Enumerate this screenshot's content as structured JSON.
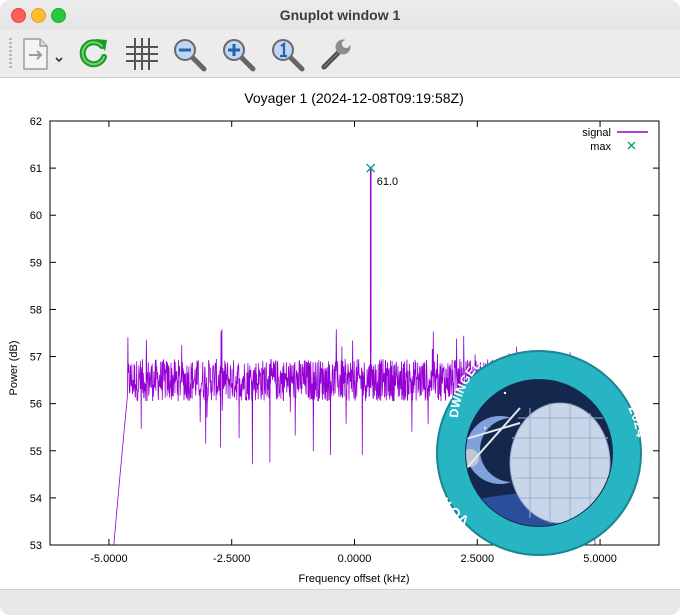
{
  "window": {
    "title": "Gnuplot window 1"
  },
  "toolbar": {
    "items": [
      {
        "name": "export-button",
        "icon": "export-document-icon"
      },
      {
        "name": "replot-button",
        "icon": "refresh-icon"
      },
      {
        "name": "grid-button",
        "icon": "grid-icon"
      },
      {
        "name": "zoom-prev-button",
        "icon": "zoom-out-icon"
      },
      {
        "name": "zoom-next-button",
        "icon": "zoom-in-icon"
      },
      {
        "name": "autoscale-button",
        "icon": "zoom-reset-icon"
      },
      {
        "name": "config-button",
        "icon": "wrench-icon"
      }
    ]
  },
  "chart_data": {
    "type": "line",
    "title": "Voyager 1 (2024-12-08T09:19:58Z)",
    "xlabel": "Frequency offset (kHz)",
    "ylabel": "Power (dB)",
    "xlim": [
      -6.2,
      6.2
    ],
    "ylim": [
      53,
      62
    ],
    "xticks": [
      "-5.0000",
      "-2.5000",
      "0.0000",
      "2.5000",
      "5.0000"
    ],
    "xtick_values": [
      -5,
      -2.5,
      0,
      2.5,
      5
    ],
    "yticks": [
      "53",
      "54",
      "55",
      "56",
      "57",
      "58",
      "59",
      "60",
      "61",
      "62"
    ],
    "grid": false,
    "legend_position": "top-right",
    "series": [
      {
        "name": "signal",
        "color": "#9400d3",
        "noise_band": {
          "x_start": -4.62,
          "x_end": 4.62,
          "mean": 56.5,
          "spread": 0.45,
          "spike_max": 57.6,
          "dip_min": 54.7
        },
        "rolloff_left": [
          [
            -4.9,
            53.0
          ],
          [
            -4.8,
            54.2
          ],
          [
            -4.72,
            55.1
          ],
          [
            -4.62,
            56.2
          ]
        ],
        "rolloff_right": [
          [
            4.62,
            56.2
          ],
          [
            4.72,
            55.1
          ],
          [
            4.8,
            54.2
          ],
          [
            4.9,
            53.0
          ]
        ],
        "carrier": {
          "x": 0.33,
          "y": 61.0
        }
      },
      {
        "name": "max",
        "color": "#009e73",
        "marker": "x",
        "points": [
          {
            "x": 0.33,
            "y": 61.0,
            "label": "61.0"
          }
        ]
      }
    ],
    "overlay_badge": {
      "texts": [
        "VOYAGER 1",
        "DWINGELOO RADIO TELESCOPE",
        "2024"
      ],
      "ring_color": "#27b4c3",
      "inner_color": "#14284e"
    }
  }
}
